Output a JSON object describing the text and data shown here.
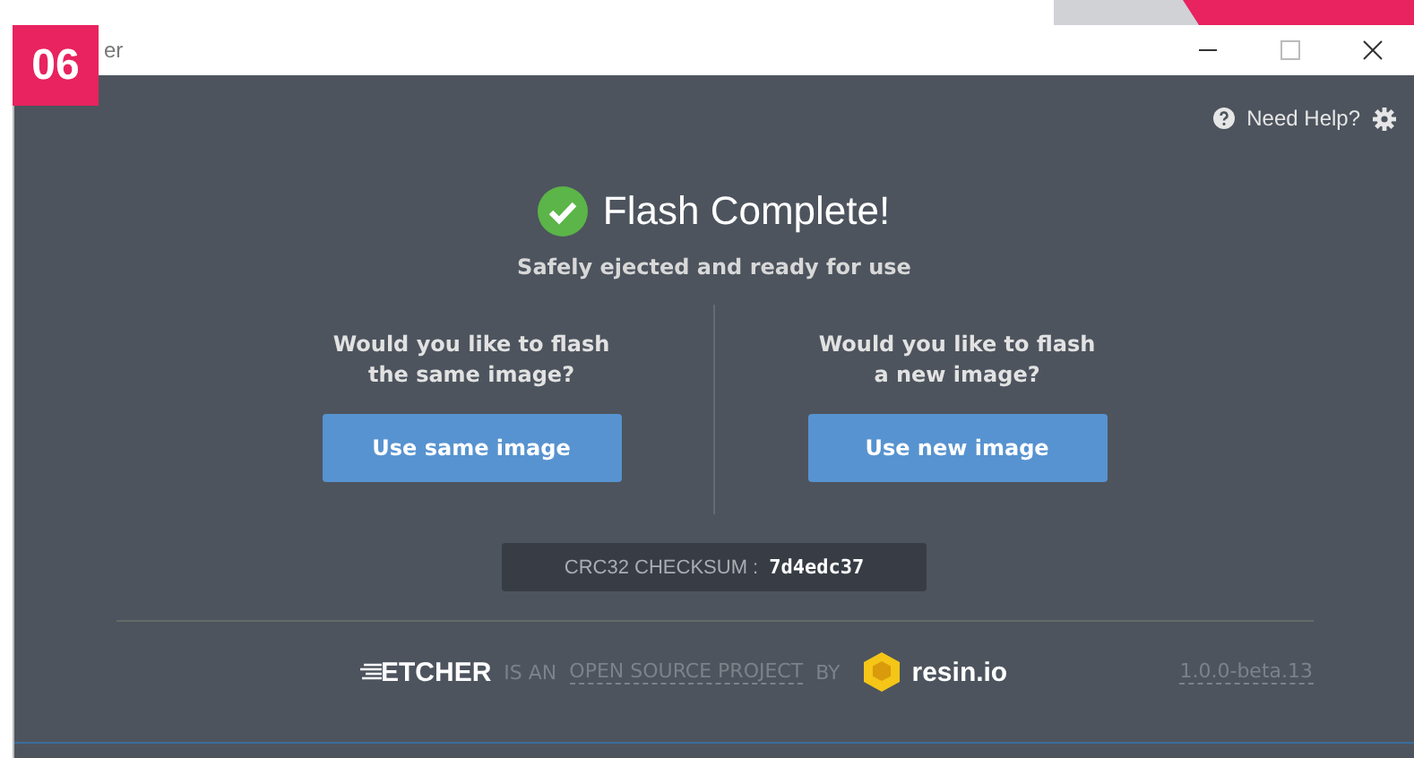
{
  "step_badge": "06",
  "window": {
    "title": "er"
  },
  "header": {
    "help_link": "Need Help?"
  },
  "status": {
    "title": "Flash Complete!",
    "subtitle": "Safely ejected and ready for use"
  },
  "options": [
    {
      "question_lines": [
        "Would you like to flash",
        "the same image?"
      ],
      "button": "Use same image"
    },
    {
      "question_lines": [
        "Would you like to flash",
        "a new image?"
      ],
      "button": "Use new image"
    }
  ],
  "checksum": {
    "label": "CRC32 CHECKSUM :",
    "value": "7d4edc37"
  },
  "footer": {
    "logo": "ETCHER",
    "tagline_prefix": "IS AN",
    "tagline_link": "OPEN SOURCE PROJECT",
    "tagline_suffix": "BY",
    "company": "resin.io",
    "version": "1.0.0-beta.13"
  }
}
